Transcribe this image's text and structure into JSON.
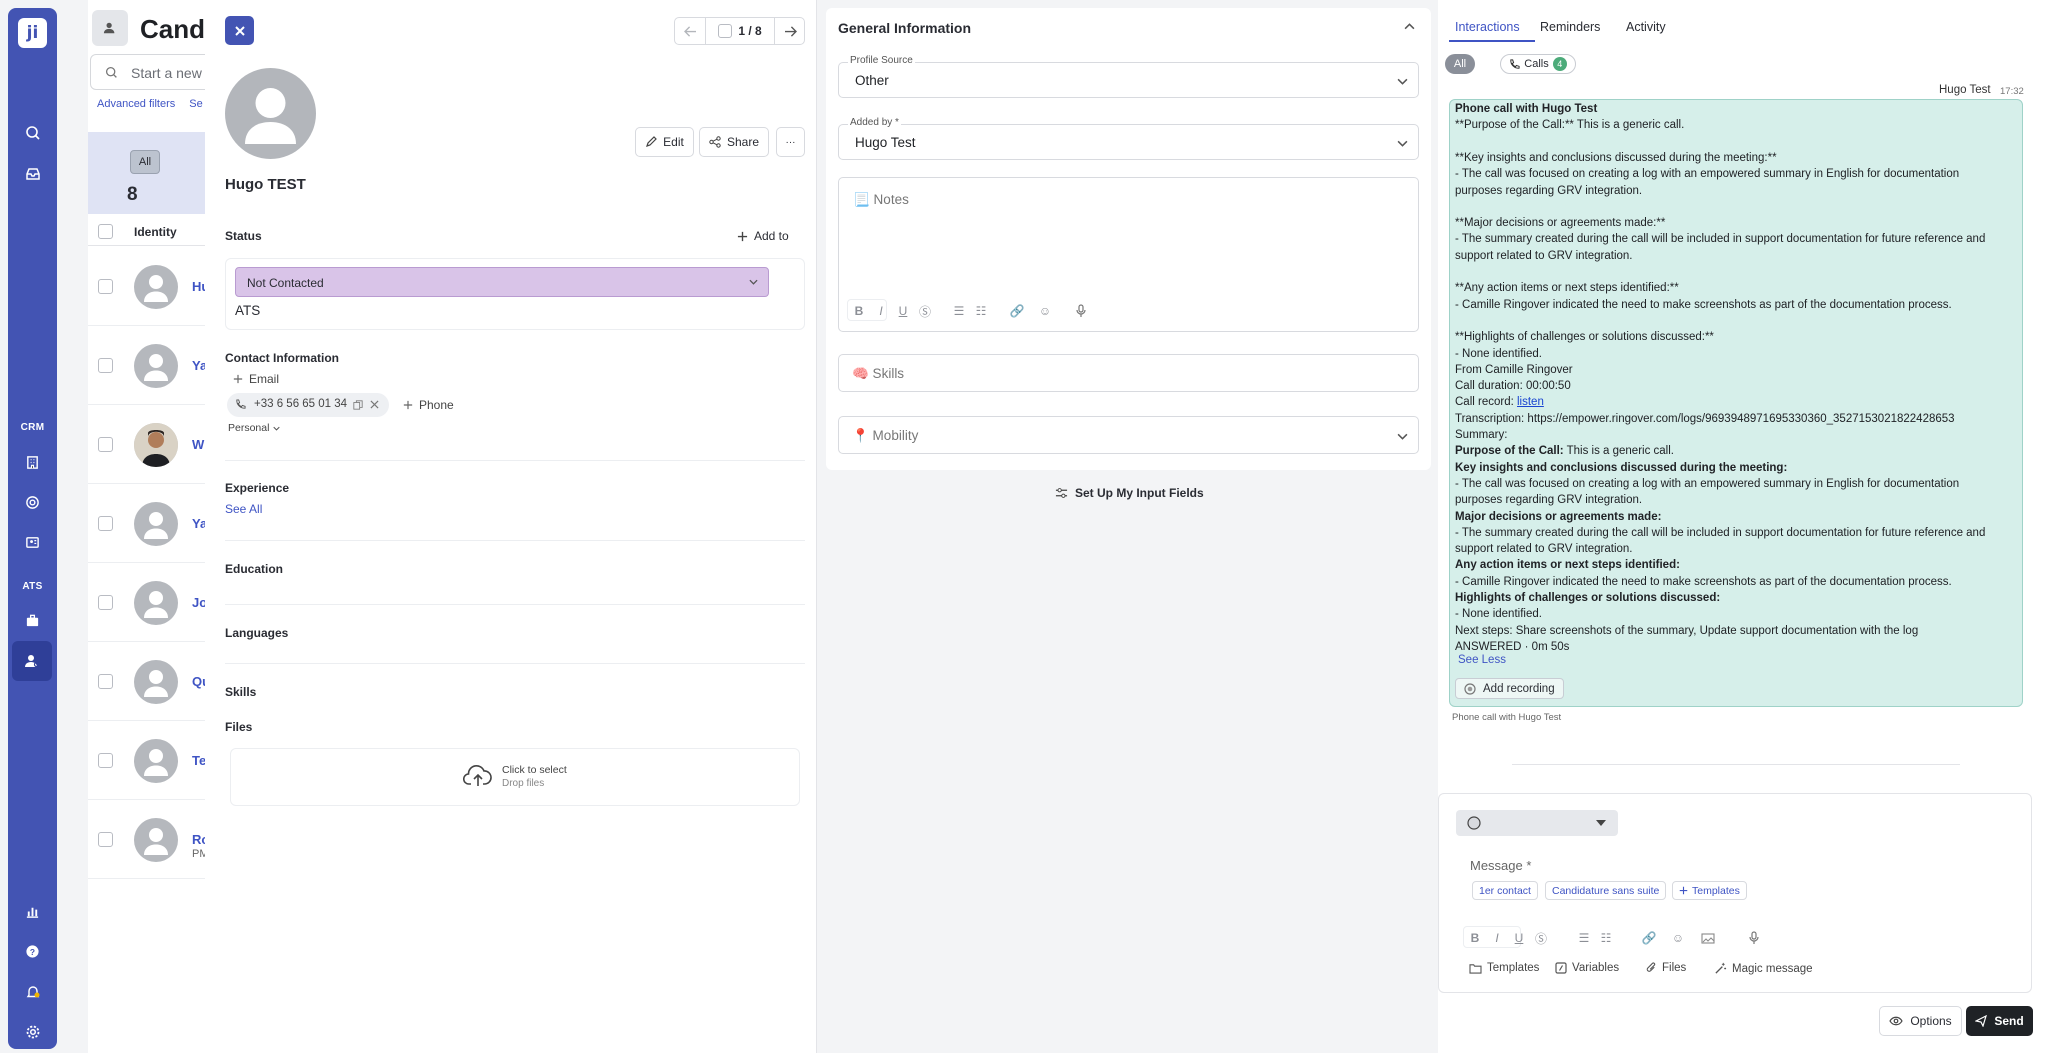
{
  "sidebar": {
    "logo": "ji",
    "crm_label": "CRM",
    "ats_label": "ATS"
  },
  "background": {
    "title": "Candi",
    "search_placeholder": "Start a new s",
    "advanced_filters": "Advanced filters",
    "se": "Se",
    "all_label": "All",
    "count": "8",
    "identity_header": "Identity",
    "rows": [
      {
        "name": "Hu",
        "sub": ""
      },
      {
        "name": "Ya",
        "sub": ""
      },
      {
        "name": "W",
        "sub": ""
      },
      {
        "name": "Ya",
        "sub": ""
      },
      {
        "name": "Jo",
        "sub": ""
      },
      {
        "name": "Qu",
        "sub": ""
      },
      {
        "name": "Te",
        "sub": ""
      },
      {
        "name": "Ro",
        "sub": "PM"
      }
    ]
  },
  "profile": {
    "pager": "1 / 8",
    "edit": "Edit",
    "share": "Share",
    "more": "···",
    "name": "Hugo TEST",
    "status_title": "Status",
    "add_to": "Add to",
    "status_value": "Not Contacted",
    "ats": "ATS",
    "contact_title": "Contact Information",
    "email_add": "Email",
    "phone": "+33 6 56 65 01 34",
    "phone_add": "Phone",
    "personal": "Personal",
    "experience_title": "Experience",
    "see_all": "See All",
    "education_title": "Education",
    "languages_title": "Languages",
    "skills_title": "Skills",
    "files_title": "Files",
    "click_to_select": "Click to select",
    "drop_files": "Drop files"
  },
  "general": {
    "title": "General Information",
    "profile_source_label": "Profile Source",
    "profile_source_value": "Other",
    "added_by_label": "Added by *",
    "added_by_value": "Hugo Test",
    "notes_placeholder": "📃 Notes",
    "skills_placeholder": "🧠 Skills",
    "mobility_placeholder": "📍 Mobility",
    "setup_fields": "Set Up My Input Fields"
  },
  "interactions": {
    "tabs": [
      "Interactions",
      "Reminders",
      "Activity"
    ],
    "filter_all": "All",
    "filter_calls": "Calls",
    "calls_count": "4",
    "author": "Hugo Test",
    "time": "17:32",
    "lines": [
      {
        "t": "Phone call with Hugo Test",
        "b": true
      },
      {
        "t": "**Purpose of the Call:** This is a generic call."
      },
      {
        "t": ""
      },
      {
        "t": "**Key insights and conclusions discussed during the meeting:**"
      },
      {
        "t": "- The call was focused on creating a log with an empowered summary in English for documentation"
      },
      {
        "t": "purposes regarding GRV integration."
      },
      {
        "t": ""
      },
      {
        "t": "**Major decisions or agreements made:**"
      },
      {
        "t": "- The summary created during the call will be included in support documentation for future reference and"
      },
      {
        "t": "support related to GRV integration."
      },
      {
        "t": ""
      },
      {
        "t": "**Any action items or next steps identified:**"
      },
      {
        "t": "- Camille Ringover indicated the need to make screenshots as part of the documentation process."
      },
      {
        "t": ""
      },
      {
        "t": "**Highlights of challenges or solutions discussed:**"
      },
      {
        "t": "- None identified."
      },
      {
        "t": "From Camille Ringover"
      },
      {
        "t": "Call duration: 00:00:50"
      },
      {
        "t": "Call record: ",
        "link": "listen"
      },
      {
        "t": "Transcription: https://empower.ringover.com/logs/9693948971695330360_3527153021822428653"
      },
      {
        "t": "Summary:"
      },
      {
        "t": "Purpose of the Call:",
        "rest": " This is a generic call.",
        "b": true
      },
      {
        "t": "Key insights and conclusions discussed during the meeting:",
        "b": true
      },
      {
        "t": "- The call was focused on creating a log with an empowered summary in English for documentation"
      },
      {
        "t": "purposes regarding GRV integration."
      },
      {
        "t": "Major decisions or agreements made:",
        "b": true
      },
      {
        "t": "- The summary created during the call will be included in support documentation for future reference and"
      },
      {
        "t": "support related to GRV integration."
      },
      {
        "t": "Any action items or next steps identified:",
        "b": true
      },
      {
        "t": "- Camille Ringover indicated the need to make screenshots as part of the documentation process."
      },
      {
        "t": "Highlights of challenges or solutions discussed:",
        "b": true
      },
      {
        "t": "- None identified."
      },
      {
        "t": "Next steps: Share screenshots of the summary, Update support documentation with the log"
      },
      {
        "t": "ANSWERED · 0m 50s"
      }
    ],
    "see_less": "See Less",
    "add_recording": "Add recording",
    "caption": "Phone call with Hugo Test"
  },
  "composer": {
    "message_label": "Message *",
    "tags": [
      "1er contact",
      "Candidature sans suite",
      "Templates"
    ],
    "templates": "Templates",
    "variables": "Variables",
    "files": "Files",
    "magic": "Magic message",
    "options": "Options",
    "send": "Send"
  }
}
